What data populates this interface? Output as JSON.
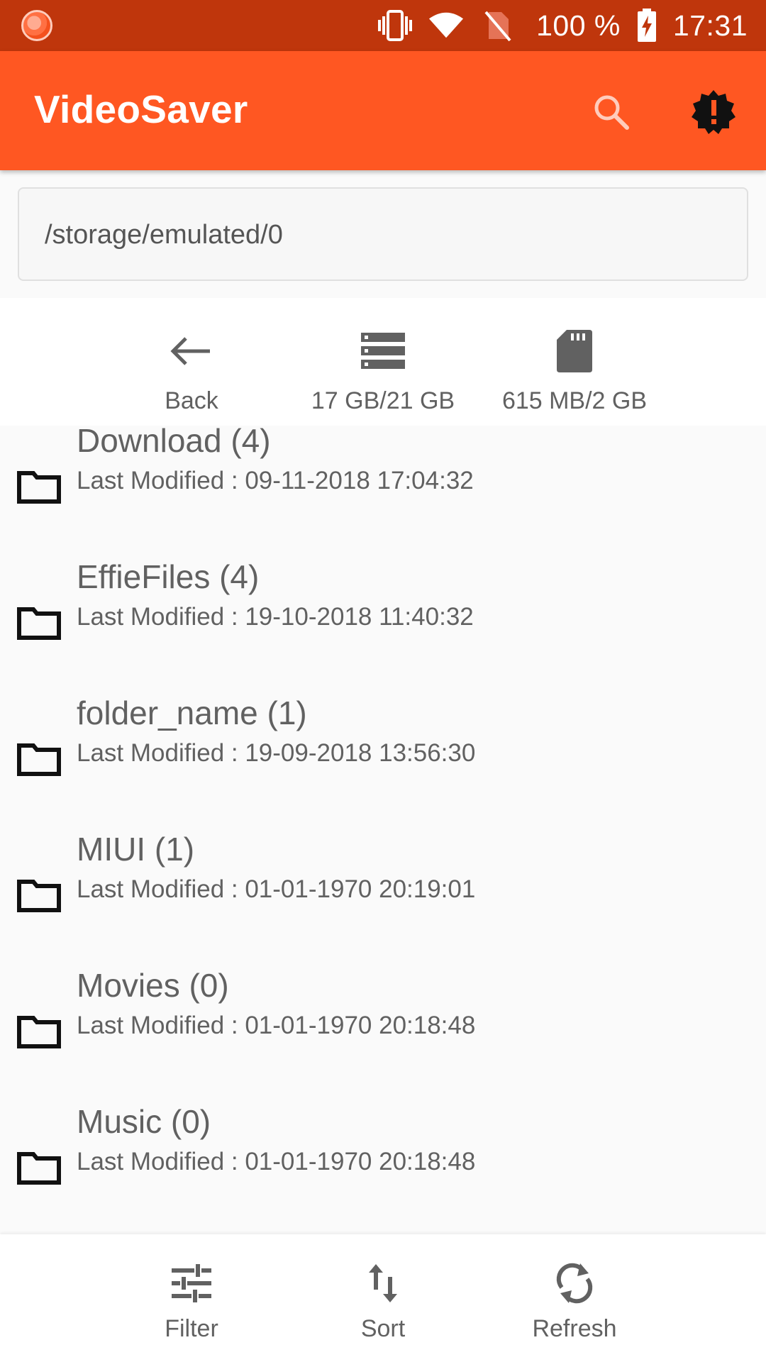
{
  "status_bar": {
    "battery_percent": "100 %",
    "time": "17:31",
    "icons": [
      "app-notification-icon",
      "vibrate-icon",
      "wifi-icon",
      "no-sim-icon",
      "battery-charging-icon"
    ]
  },
  "app_bar": {
    "title": "VideoSaver",
    "actions": [
      "search-icon",
      "alert-badge-icon"
    ],
    "color": "#ff5722",
    "status_color": "#bf360c"
  },
  "path": {
    "value": "/storage/emulated/0"
  },
  "nav": {
    "back_label": "Back",
    "internal_label": "17 GB/21 GB",
    "sd_label": "615 MB/2 GB",
    "icons": [
      "arrow-left-icon",
      "storage-icon",
      "sd-card-icon"
    ]
  },
  "folders": [
    {
      "name": "Download (4)",
      "modified_prefix": "Last Modified : ",
      "modified": "09-11-2018 17:04:32"
    },
    {
      "name": "EffieFiles (4)",
      "modified_prefix": "Last Modified : ",
      "modified": "19-10-2018 11:40:32"
    },
    {
      "name": "folder_name (1)",
      "modified_prefix": "Last Modified : ",
      "modified": "19-09-2018 13:56:30"
    },
    {
      "name": "MIUI (1)",
      "modified_prefix": "Last Modified : ",
      "modified": "01-01-1970 20:19:01"
    },
    {
      "name": "Movies (0)",
      "modified_prefix": "Last Modified : ",
      "modified": "01-01-1970 20:18:48"
    },
    {
      "name": "Music (0)",
      "modified_prefix": "Last Modified : ",
      "modified": "01-01-1970 20:18:48"
    }
  ],
  "bottom_bar": {
    "filter_label": "Filter",
    "sort_label": "Sort",
    "refresh_label": "Refresh",
    "icons": [
      "tune-icon",
      "sort-icon",
      "refresh-icon"
    ]
  }
}
